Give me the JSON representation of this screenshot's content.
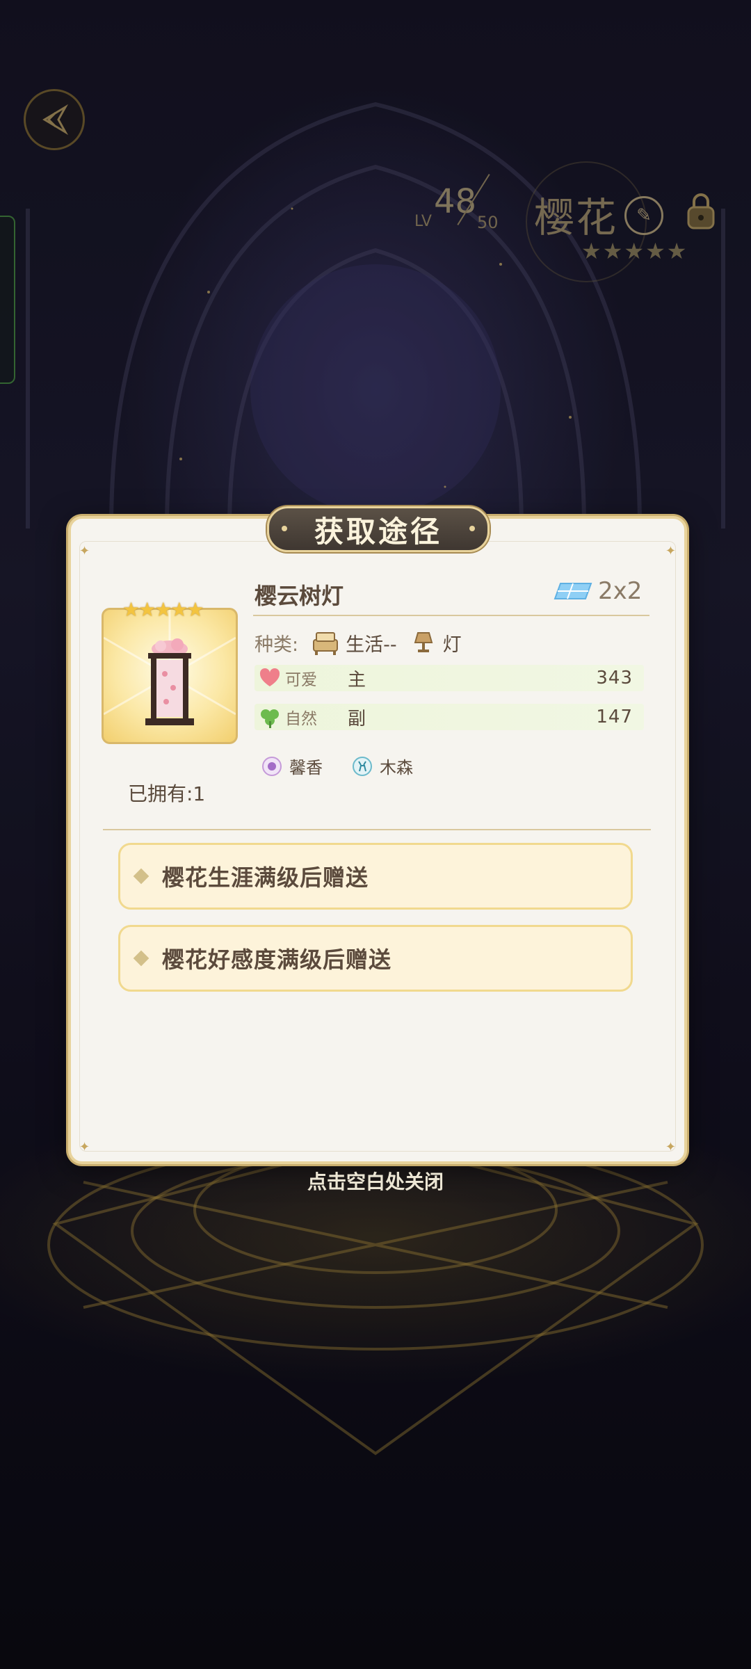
{
  "header": {
    "lv_label": "LV",
    "level": "48",
    "level_max": "50",
    "character_name": "樱花",
    "character_stars": "★★★★★"
  },
  "dialog": {
    "title": "获取途径",
    "item": {
      "name": "樱云树灯",
      "stars": "★★★★★",
      "owned": "已拥有:1",
      "size": "2x2",
      "type_label": "种类:",
      "category": "生活--",
      "subcategory": "灯",
      "stats": [
        {
          "label": "可爱",
          "role": "主",
          "value": "343",
          "icon": "heart-icon",
          "color": "#ef7f8a"
        },
        {
          "label": "自然",
          "role": "副",
          "value": "147",
          "icon": "clover-icon",
          "color": "#6dbb4e"
        }
      ],
      "tags": [
        {
          "label": "馨香",
          "icon": "fragrance-icon"
        },
        {
          "label": "木森",
          "icon": "deer-icon"
        }
      ]
    },
    "sources": [
      "樱花生涯满级后赠送",
      "樱花好感度满级后赠送"
    ]
  },
  "close_hint": "点击空白处关闭"
}
